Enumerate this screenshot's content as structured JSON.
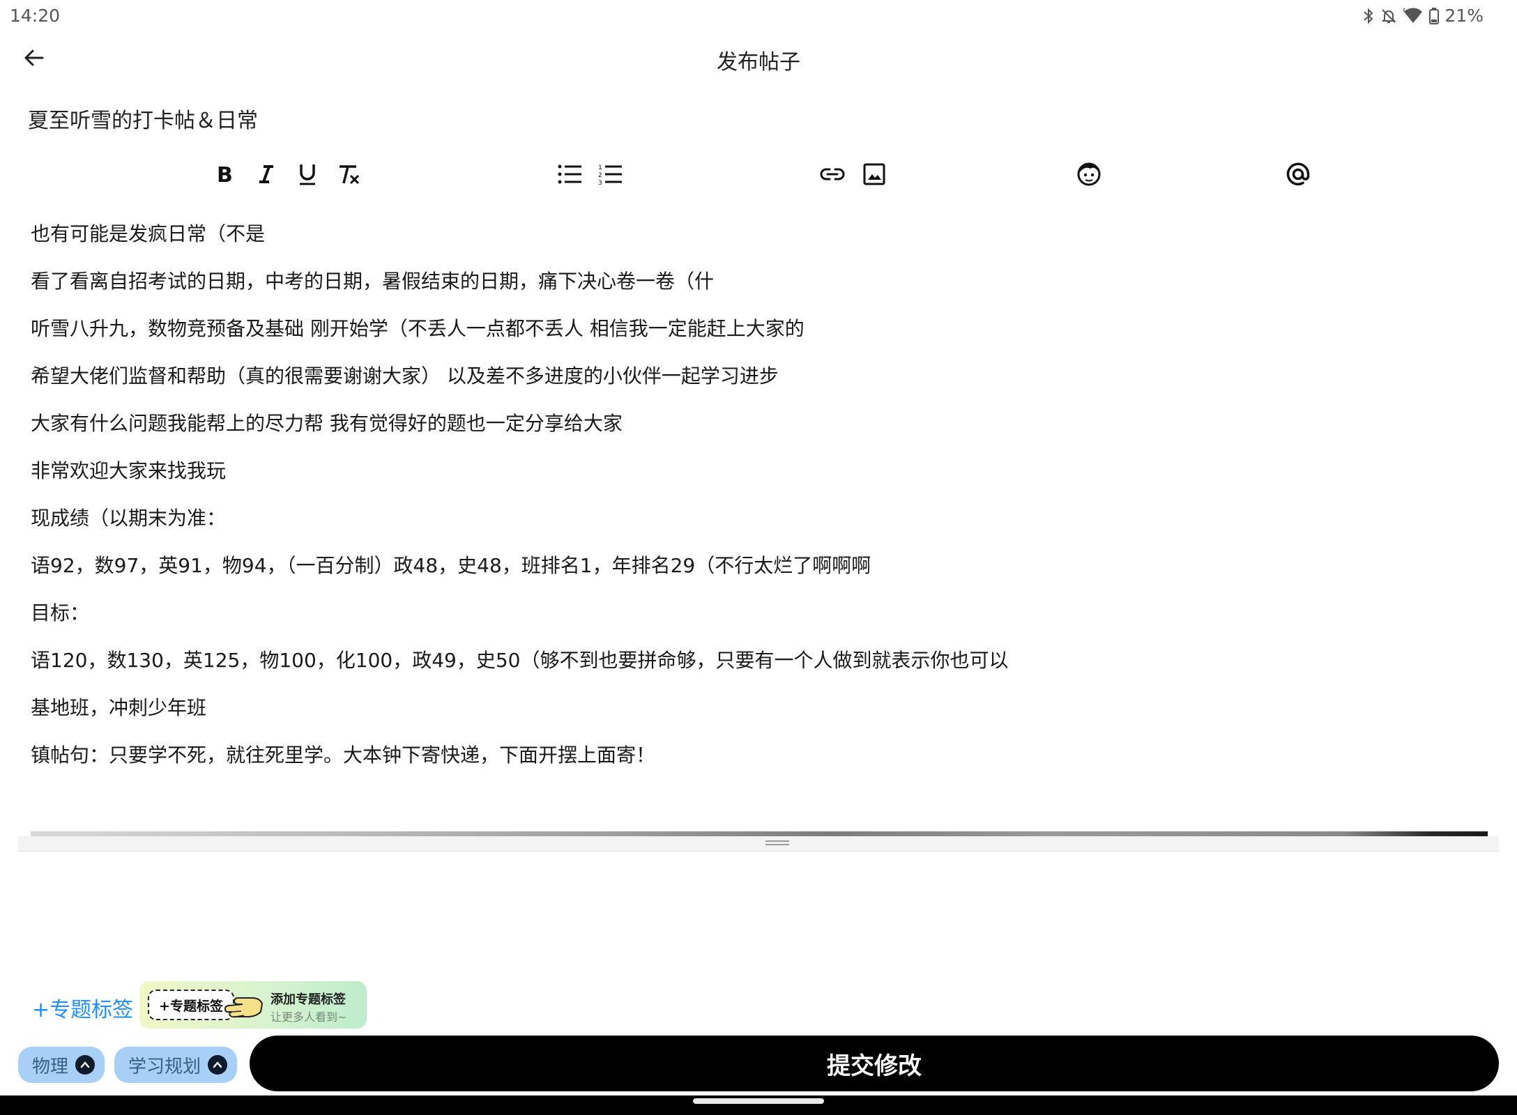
{
  "status_bar": {
    "time": "14:20",
    "battery": "21%",
    "icons": [
      "bluetooth-icon",
      "notifications-off-icon",
      "wifi-icon",
      "battery-icon"
    ]
  },
  "header": {
    "title": "发布帖子",
    "back_icon": "arrow-left-icon"
  },
  "post": {
    "title": "夏至听雪的打卡帖＆日常"
  },
  "toolbar": {
    "bold_label": "B",
    "italic_label": "I",
    "underline_label": "U",
    "icons": [
      "bold-icon",
      "italic-icon",
      "underline-icon",
      "clear-format-icon",
      "bullet-list-icon",
      "numbered-list-icon",
      "link-icon",
      "image-icon",
      "emoji-icon",
      "mention-icon"
    ]
  },
  "content": {
    "lines": [
      "也有可能是发疯日常（不是",
      "看了看离自招考试的日期，中考的日期，暑假结束的日期，痛下决心卷一卷（什",
      "听雪八升九，数物竞预备及基础 刚开始学（不丢人一点都不丢人 相信我一定能赶上大家的",
      "希望大佬们监督和帮助（真的很需要谢谢大家） 以及差不多进度的小伙伴一起学习进步",
      "大家有什么问题我能帮上的尽力帮 我有觉得好的题也一定分享给大家",
      "非常欢迎大家来找我玩",
      "现成绩（以期末为准：",
      "语92，数97，英91，物94，（一百分制）政48，史48，班排名1，年排名29（不行太烂了啊啊啊",
      "目标：",
      "语120，数130，英125，物100，化100，政49，史50（够不到也要拼命够，只要有一个人做到就表示你也可以",
      "基地班，冲刺少年班",
      "镇帖句：只要学不死，就往死里学。大本钟下寄快递，下面开摆上面寄！"
    ]
  },
  "topic": {
    "add_label": "+专题标签",
    "banner_tag": "+专题标签",
    "banner_title": "添加专题标签",
    "banner_subtitle": "让更多人看到~"
  },
  "chips": [
    {
      "label": "物理"
    },
    {
      "label": "学习规划"
    }
  ],
  "submit": {
    "label": "提交修改"
  },
  "colors": {
    "accent": "#1f8fff",
    "chip_bg": "#a8cff5",
    "submit_bg": "#000000"
  }
}
